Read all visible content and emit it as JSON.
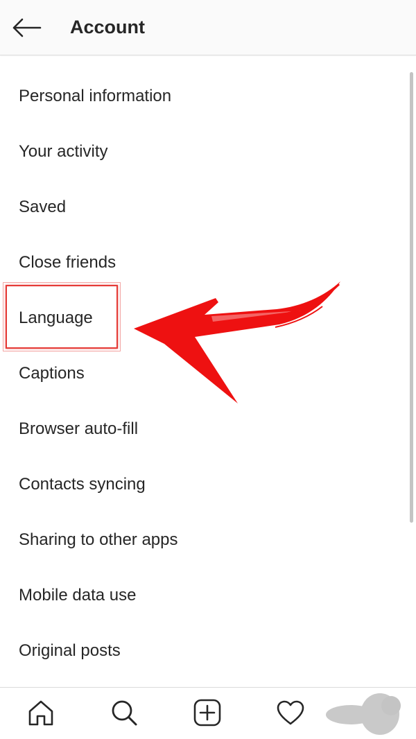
{
  "header": {
    "back_icon": "arrow-left-icon",
    "title": "Account"
  },
  "menu": {
    "items": [
      {
        "label": "Personal information"
      },
      {
        "label": "Your activity"
      },
      {
        "label": "Saved"
      },
      {
        "label": "Close friends"
      },
      {
        "label": "Language"
      },
      {
        "label": "Captions"
      },
      {
        "label": "Browser auto-fill"
      },
      {
        "label": "Contacts syncing"
      },
      {
        "label": "Sharing to other apps"
      },
      {
        "label": "Mobile data use"
      },
      {
        "label": "Original posts"
      }
    ]
  },
  "annotation": {
    "highlight_color": "#e53935",
    "arrow_color": "#ee1111"
  },
  "bottom_nav": {
    "icons": [
      "home-icon",
      "search-icon",
      "new-post-icon",
      "activity-heart-icon",
      "profile-avatar-icon"
    ]
  },
  "colors": {
    "text": "#262626",
    "header_bg": "#fafafa",
    "divider": "#dbdbdb"
  }
}
